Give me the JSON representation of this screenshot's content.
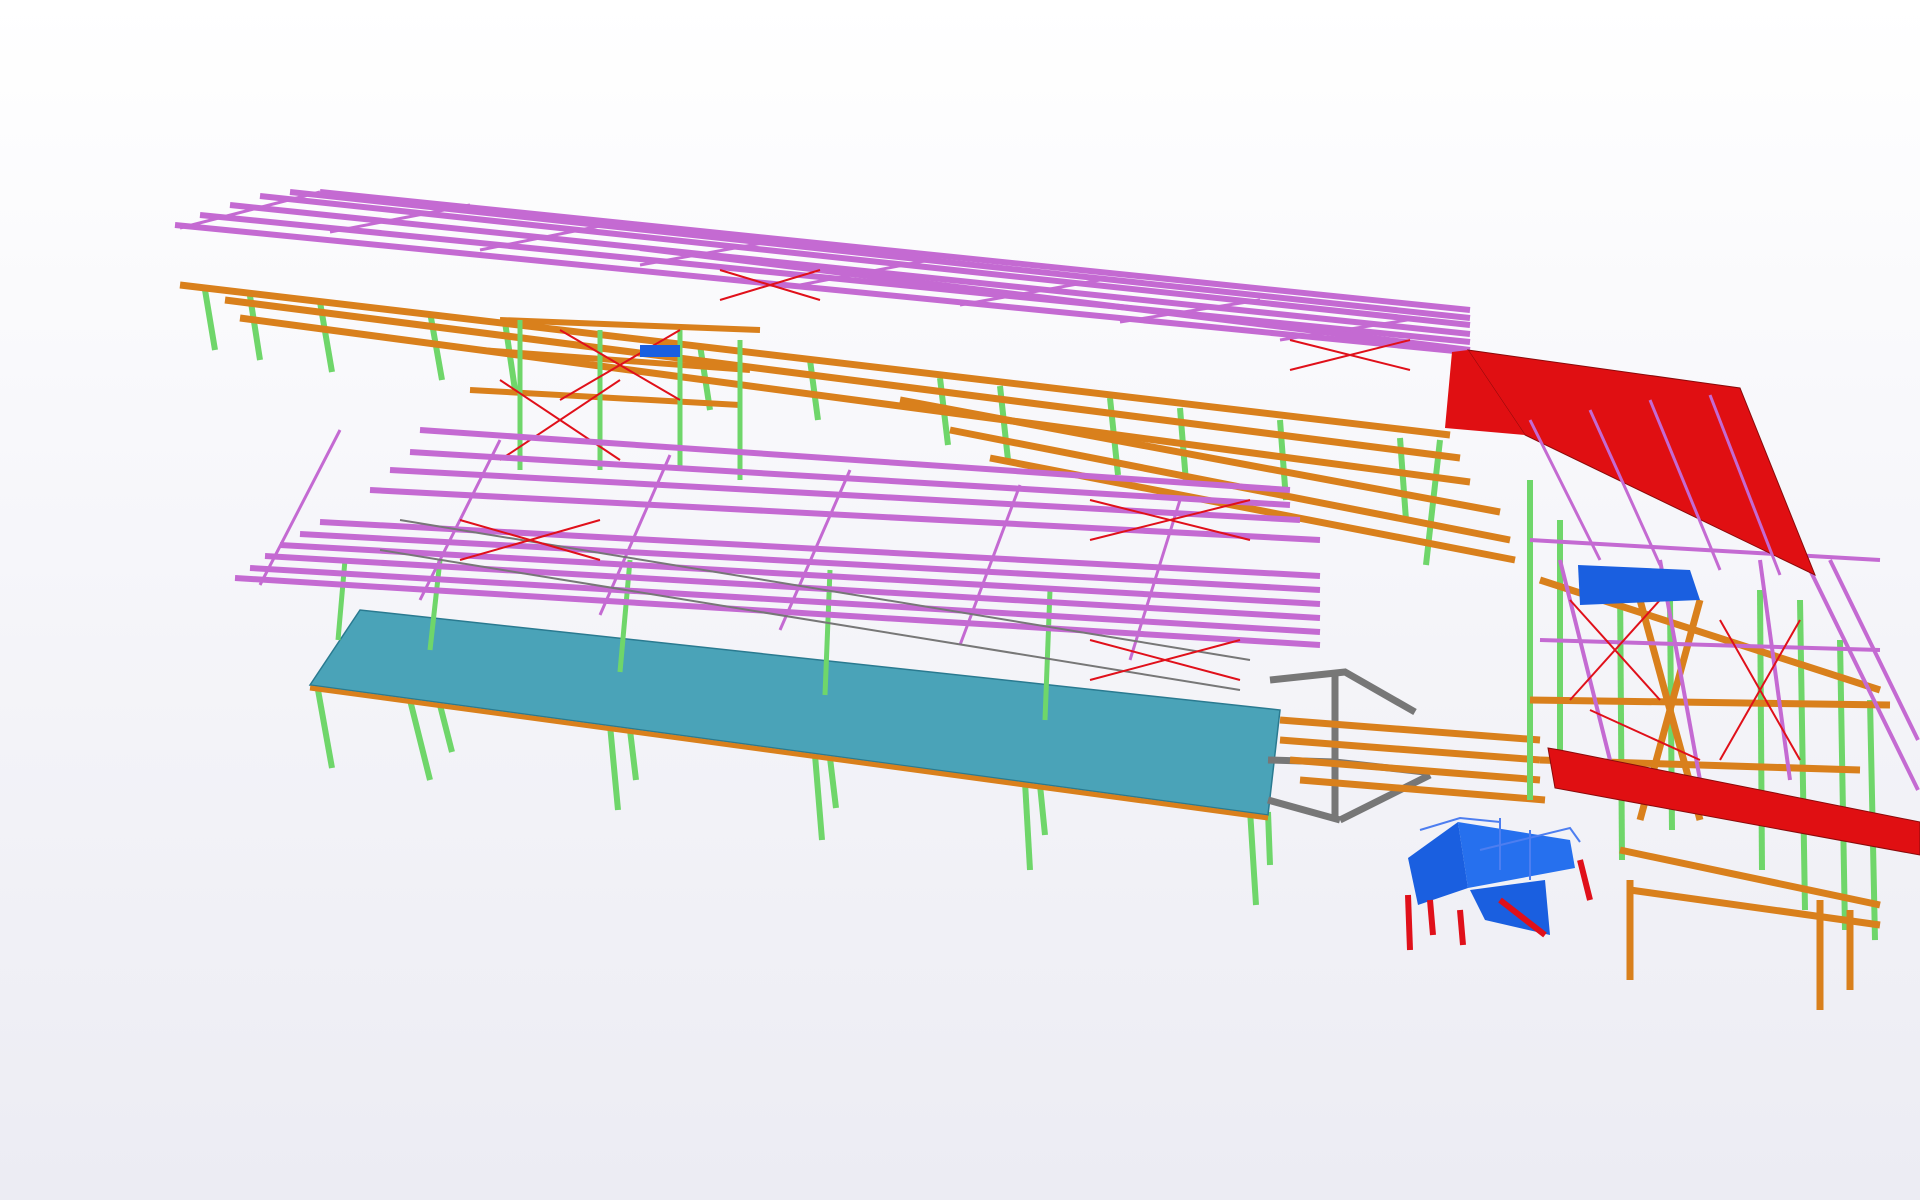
{
  "viewport": {
    "background_top": "#ffffff",
    "background_bottom": "#ececf3"
  },
  "colors": {
    "roof_purlin": "#c46ad2",
    "beam": "#d9801c",
    "column": "#6fd66a",
    "brace": "#e0101a",
    "slab_teal": "#4aa3b8",
    "roof_red": "#e00f12",
    "stair_blue": "#1a5fe0",
    "connector_grey": "#777777",
    "outline": "#5a4a3a"
  },
  "model": {
    "parts": [
      "upper-roof-frame",
      "lower-roof-frame",
      "teal-floor-slab",
      "red-roof-wing",
      "steel-stair",
      "grey-connector-bridge",
      "north-wing-colonnade",
      "east-wing-frame"
    ]
  }
}
